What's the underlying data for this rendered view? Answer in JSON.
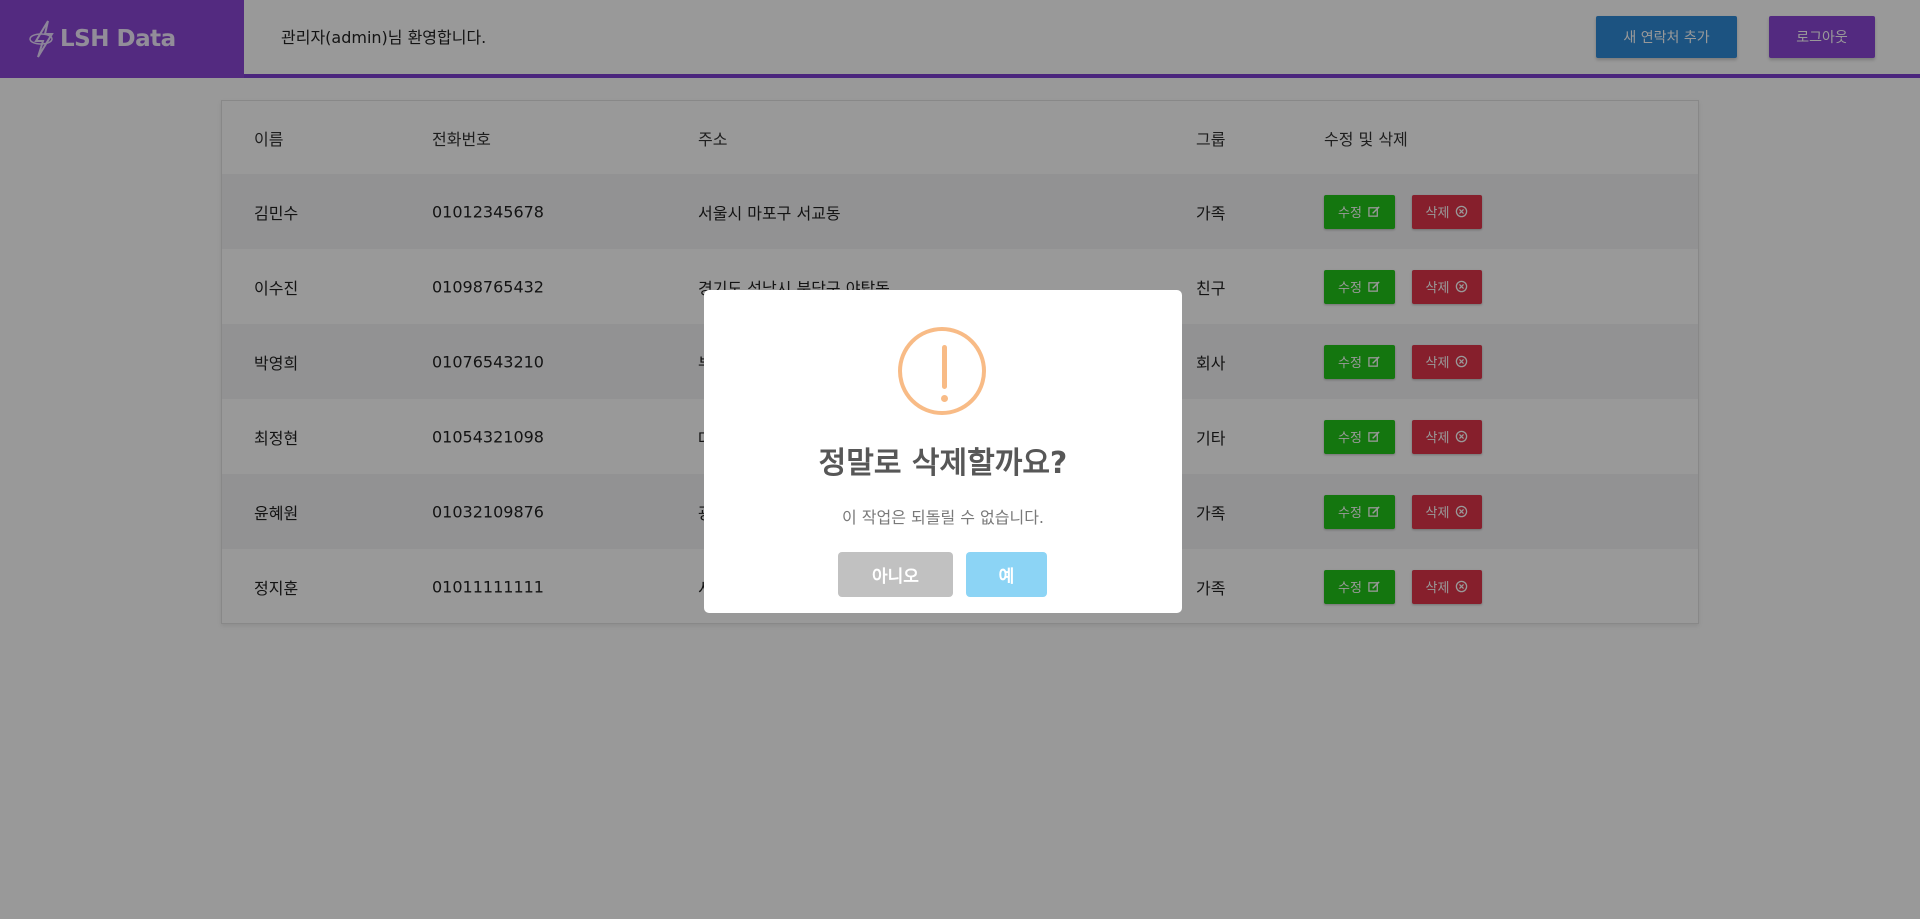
{
  "header": {
    "brand": "LSH Data",
    "welcome": "관리자(admin)님 환영합니다.",
    "new_contact_label": "새 연락처 추가",
    "logout_label": "로그아웃"
  },
  "table": {
    "columns": [
      "이름",
      "전화번호",
      "주소",
      "그룹",
      "수정 및 삭제"
    ],
    "edit_label": "수정",
    "delete_label": "삭제",
    "rows": [
      {
        "name": "김민수",
        "phone": "01012345678",
        "address": "서울시 마포구 서교동",
        "group": "가족"
      },
      {
        "name": "이수진",
        "phone": "01098765432",
        "address": "경기도 성남시 분당구 야탑동",
        "group": "친구"
      },
      {
        "name": "박영희",
        "phone": "01076543210",
        "address": "부",
        "group": "회사"
      },
      {
        "name": "최정현",
        "phone": "01054321098",
        "address": "대",
        "group": "기타"
      },
      {
        "name": "윤혜원",
        "phone": "01032109876",
        "address": "광",
        "group": "가족"
      },
      {
        "name": "정지훈",
        "phone": "01011111111",
        "address": "서",
        "group": "가족"
      }
    ]
  },
  "modal": {
    "title": "정말로 삭제할까요?",
    "text": "이 작업은 되돌릴 수 없습니다.",
    "no_label": "아니오",
    "yes_label": "예"
  },
  "colors": {
    "brand": "#8a46d6",
    "primary": "#2f8bd8",
    "edit": "#22c51a",
    "delete": "#e0344a",
    "warning": "#f8bb86",
    "confirm": "#8cd4f5",
    "cancel": "#c1c1c1"
  }
}
